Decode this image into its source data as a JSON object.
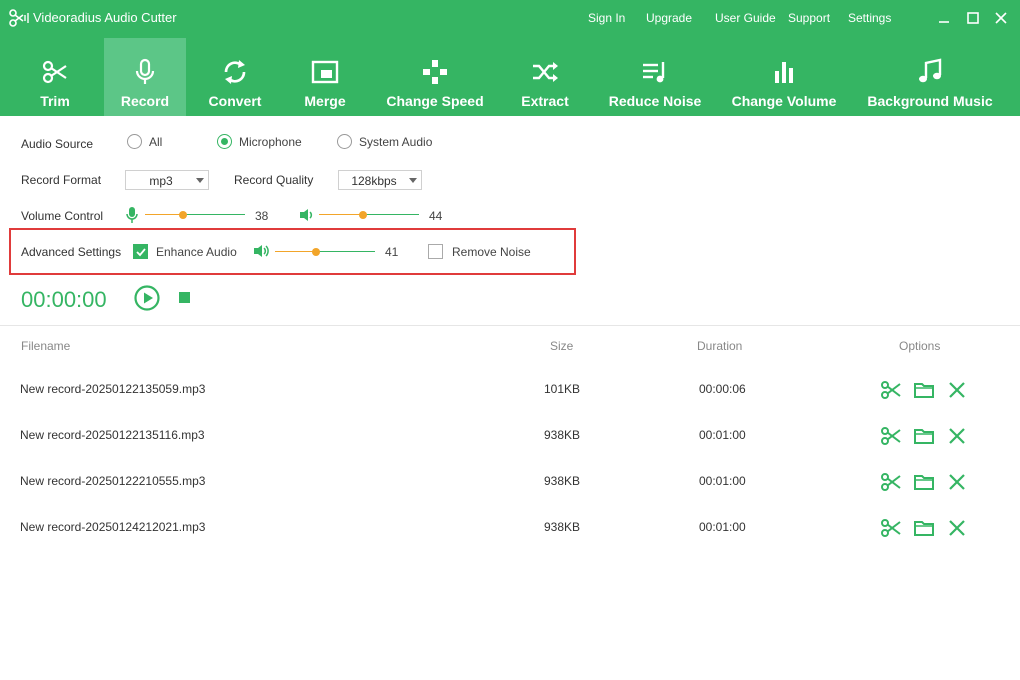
{
  "app": {
    "title": "Videoradius Audio Cutter"
  },
  "topnav": [
    "Sign In",
    "Upgrade",
    "User Guide",
    "Support",
    "Settings"
  ],
  "tools": [
    {
      "label": "Trim",
      "icon": "scissors-icon"
    },
    {
      "label": "Record",
      "icon": "microphone-icon",
      "active": true
    },
    {
      "label": "Convert",
      "icon": "convert-icon"
    },
    {
      "label": "Merge",
      "icon": "merge-icon"
    },
    {
      "label": "Change Speed",
      "icon": "gamepad-icon"
    },
    {
      "label": "Extract",
      "icon": "shuffle-icon"
    },
    {
      "label": "Reduce Noise",
      "icon": "noise-icon"
    },
    {
      "label": "Change Volume",
      "icon": "bars-icon"
    },
    {
      "label": "Background Music",
      "icon": "music-note-icon"
    }
  ],
  "settings": {
    "audio_source": {
      "label": "Audio Source",
      "options": [
        "All",
        "Microphone",
        "System Audio"
      ],
      "selected": "Microphone"
    },
    "record_format": {
      "label": "Record Format",
      "value": "mp3"
    },
    "record_quality": {
      "label": "Record Quality",
      "value": "128kbps"
    },
    "volume_control": {
      "label": "Volume Control",
      "mic_value": "38",
      "speaker_value": "44",
      "mic_level": 0.38,
      "speaker_level": 0.44
    },
    "advanced": {
      "label": "Advanced Settings",
      "enhance_label": "Enhance Audio",
      "enhance_checked": true,
      "enhance_value": "41",
      "enhance_level": 0.41,
      "noise_label": "Remove Noise",
      "noise_checked": false
    }
  },
  "timer": "00:00:00",
  "table": {
    "headers": {
      "filename": "Filename",
      "size": "Size",
      "duration": "Duration",
      "options": "Options"
    },
    "rows": [
      {
        "filename": "New record-20250122135059.mp3",
        "size": "101KB",
        "duration": "00:00:06"
      },
      {
        "filename": "New record-20250122135116.mp3",
        "size": "938KB",
        "duration": "00:01:00"
      },
      {
        "filename": "New record-20250122210555.mp3",
        "size": "938KB",
        "duration": "00:01:00"
      },
      {
        "filename": "New record-20250124212021.mp3",
        "size": "938KB",
        "duration": "00:01:00"
      }
    ]
  },
  "colors": {
    "accent": "#35b563",
    "active_tab": "#5cc687",
    "slider_knob": "#f2a52a",
    "highlight_box": "#e03b3b"
  }
}
